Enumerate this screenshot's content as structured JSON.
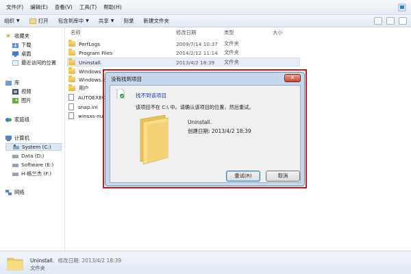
{
  "menu": [
    "文件(F)",
    "编辑(E)",
    "查看(V)",
    "工具(T)",
    "帮助(H)"
  ],
  "toolbar": {
    "organize": "组织",
    "open": "打开",
    "include_in_library": "包含到库中",
    "share": "共享",
    "burn": "刻录",
    "new_folder": "新建文件夹"
  },
  "sidebar": {
    "favorites": "收藏夹",
    "downloads": "下载",
    "desktop": "桌面",
    "recent": "最近访问的位置",
    "libraries": "库",
    "videos": "视频",
    "pictures": "图片",
    "homegroup": "家庭组",
    "computer": "计算机",
    "drive_c": "System (C:)",
    "drive_d": "Data (D:)",
    "drive_e": "Software (E:)",
    "drive_f": "H-格兰杰 (F:)",
    "network": "网络"
  },
  "columns": {
    "name": "名称",
    "modified": "修改日期",
    "type": "类型",
    "size": "大小"
  },
  "files": [
    {
      "name": "PerfLogs",
      "date": "2009/7/14 10:37",
      "type": "文件夹",
      "kind": "folder"
    },
    {
      "name": "Program Files",
      "date": "2014/2/12 11:14",
      "type": "文件夹",
      "kind": "folder"
    },
    {
      "name": "Uninstall.",
      "date": "2013/4/2 18:39",
      "type": "文件夹",
      "kind": "folder"
    },
    {
      "name": "Windows",
      "date": "",
      "type": "",
      "kind": "folder"
    },
    {
      "name": "Windows.o",
      "date": "",
      "type": "",
      "kind": "folder"
    },
    {
      "name": "用户",
      "date": "",
      "type": "",
      "kind": "folder"
    },
    {
      "name": "AUTOEXEC",
      "date": "",
      "type": "",
      "kind": "file"
    },
    {
      "name": "snap.ini",
      "date": "",
      "type": "",
      "kind": "file"
    },
    {
      "name": "winsxs-nul",
      "date": "",
      "type": "",
      "kind": "file"
    }
  ],
  "dialog": {
    "title": "没有找到项目",
    "heading": "找不到该项目",
    "message": "该项目不在 C:\\ 中。请确认该项目的位置，然后重试。",
    "item_name": "Uninstall.",
    "created": "创建日期: 2013/4/2 18:39",
    "retry": "重试(R)",
    "cancel": "取消",
    "close": "✕"
  },
  "status": {
    "name": "Uninstall.",
    "modified_label": "修改日期: 2013/4/2 18:39",
    "type": "文件夹"
  }
}
